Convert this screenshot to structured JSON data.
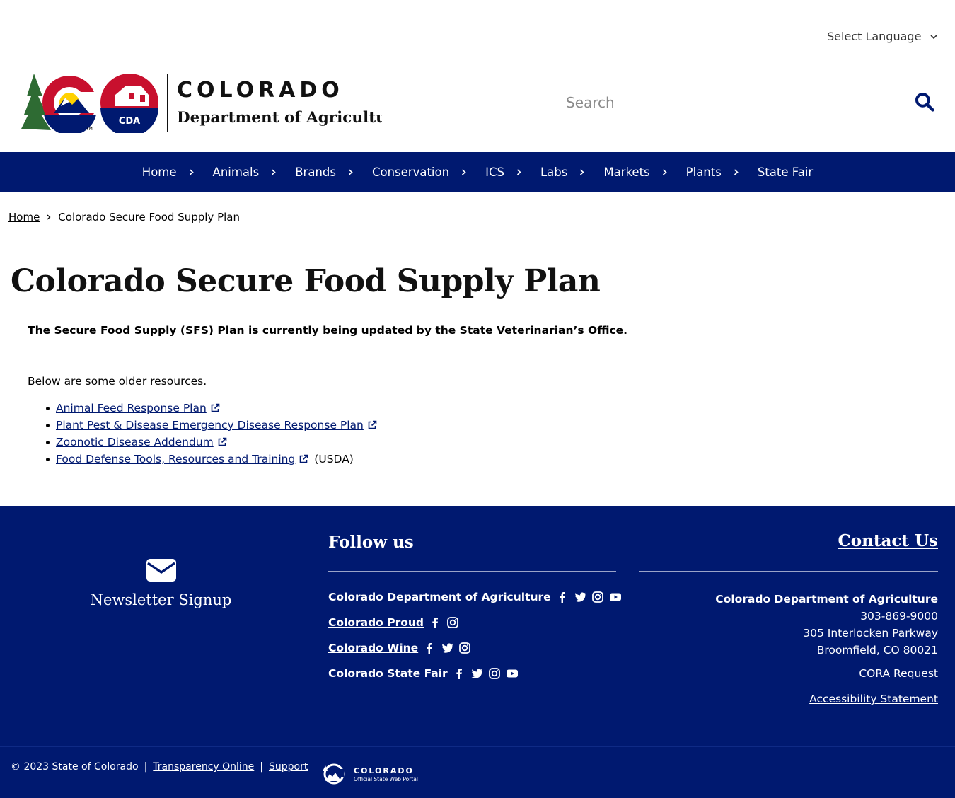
{
  "header": {
    "language_label": "Select Language",
    "logo": {
      "state": "COLORADO",
      "department": "Department of Agriculture",
      "badge": "CDA"
    },
    "search_placeholder": "Search"
  },
  "nav": [
    "Home",
    "Animals",
    "Brands",
    "Conservation",
    "ICS",
    "Labs",
    "Markets",
    "Plants",
    "State Fair"
  ],
  "breadcrumb": {
    "home": "Home",
    "current": "Colorado Secure Food Supply Plan"
  },
  "main": {
    "title": "Colorado Secure Food Supply Plan",
    "intro": "The Secure Food Supply (SFS) Plan is currently being updated by the State Veterinarian’s Office.",
    "older": "Below are some older resources.",
    "resources": [
      {
        "label": "Animal Feed Response Plan",
        "suffix": ""
      },
      {
        "label": "Plant Pest & Disease Emergency Disease Response Plan",
        "suffix": ""
      },
      {
        "label": "Zoonotic Disease Addendum",
        "suffix": ""
      },
      {
        "label": "Food Defense Tools, Resources and Training",
        "suffix": "(USDA)"
      }
    ]
  },
  "footer": {
    "newsletter": "Newsletter Signup",
    "follow_title": "Follow us",
    "social": [
      {
        "name": "Colorado Department of Agriculture",
        "icons": [
          "facebook-icon",
          "twitter-icon",
          "instagram-icon",
          "youtube-icon"
        ]
      },
      {
        "name": "Colorado Proud",
        "icons": [
          "facebook-icon",
          "instagram-icon"
        ]
      },
      {
        "name": "Colorado Wine",
        "icons": [
          "facebook-icon",
          "twitter-icon",
          "instagram-icon"
        ]
      },
      {
        "name": "Colorado State Fair",
        "icons": [
          "facebook-icon",
          "twitter-icon",
          "instagram-icon",
          "youtube-icon"
        ]
      }
    ],
    "contact_title": "Contact Us",
    "contact": {
      "org": "Colorado Department of Agriculture",
      "phone": "303-869-9000",
      "street": "305 Interlocken Parkway",
      "city": "Broomfield, CO 80021"
    },
    "cora": "CORA Request",
    "accessibility": "Accessibility Statement"
  },
  "bottom": {
    "copyright": "© 2023 State of Colorado",
    "sep": "|",
    "transparency": "Transparency Online",
    "support": "Support",
    "portal": {
      "name": "COLORADO",
      "tagline": "Official State Web Portal"
    }
  },
  "colors": {
    "navy": "#001970",
    "red": "#c8102e",
    "gold": "#ffd100",
    "green": "#2e6b33"
  }
}
